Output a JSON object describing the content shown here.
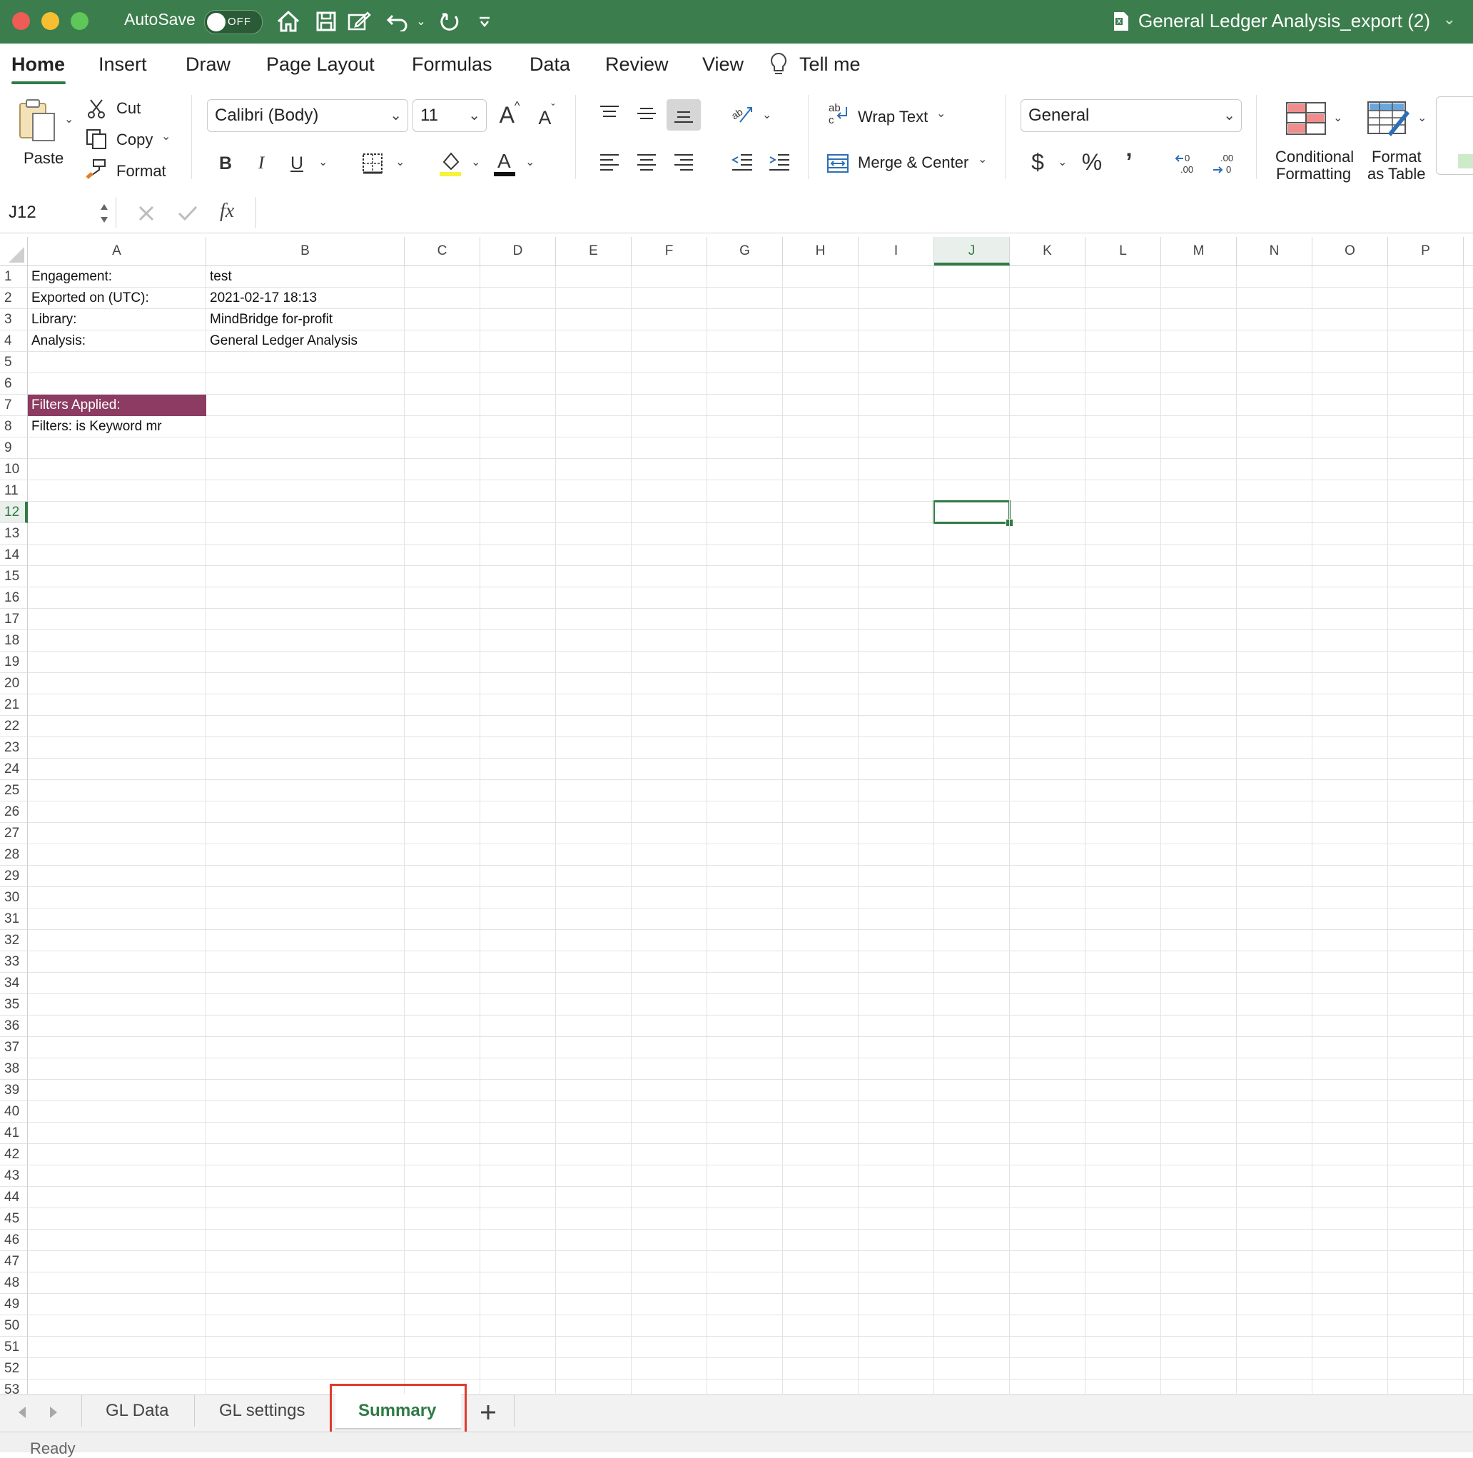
{
  "titlebar": {
    "autosave_label": "AutoSave",
    "autosave_state": "OFF",
    "document_title": "General Ledger Analysis_export (2)",
    "accent_color": "#3b7d4c"
  },
  "ribbon_tabs": [
    "Home",
    "Insert",
    "Draw",
    "Page Layout",
    "Formulas",
    "Data",
    "Review",
    "View"
  ],
  "tell_me": "Tell me",
  "ribbon": {
    "paste": "Paste",
    "cut": "Cut",
    "copy": "Copy",
    "format": "Format",
    "font_name": "Calibri (Body)",
    "font_size": "11",
    "bold": "B",
    "italic": "I",
    "underline": "U",
    "wrap_text": "Wrap Text",
    "merge_center": "Merge & Center",
    "number_format": "General",
    "currency": "$",
    "percent": "%",
    "comma": "’",
    "conditional_formatting_1": "Conditional",
    "conditional_formatting_2": "Formatting",
    "format_table_1": "Format",
    "format_table_2": "as Table"
  },
  "formula_bar": {
    "name_box": "J12",
    "fx": "fx",
    "value": ""
  },
  "grid": {
    "columns": [
      "A",
      "B",
      "C",
      "D",
      "E",
      "F",
      "G",
      "H",
      "I",
      "J",
      "K",
      "L",
      "M",
      "N",
      "O",
      "P"
    ],
    "selected_column": "J",
    "selected_row": 12,
    "visible_rows": 53,
    "cells": {
      "A1": "Engagement:",
      "B1": "test",
      "A2": "Exported on (UTC):",
      "B2": "2021-02-17 18:13",
      "A3": "Library:",
      "B3": "MindBridge for-profit",
      "A4": "Analysis:",
      "B4": "General Ledger Analysis",
      "A7": "Filters Applied:",
      "A8": "Filters: is Keyword mr"
    },
    "filled_cell_color": "#8c3b62"
  },
  "sheet_tabs": [
    "GL Data",
    "GL settings",
    "Summary"
  ],
  "active_sheet": "Summary",
  "status": "Ready"
}
